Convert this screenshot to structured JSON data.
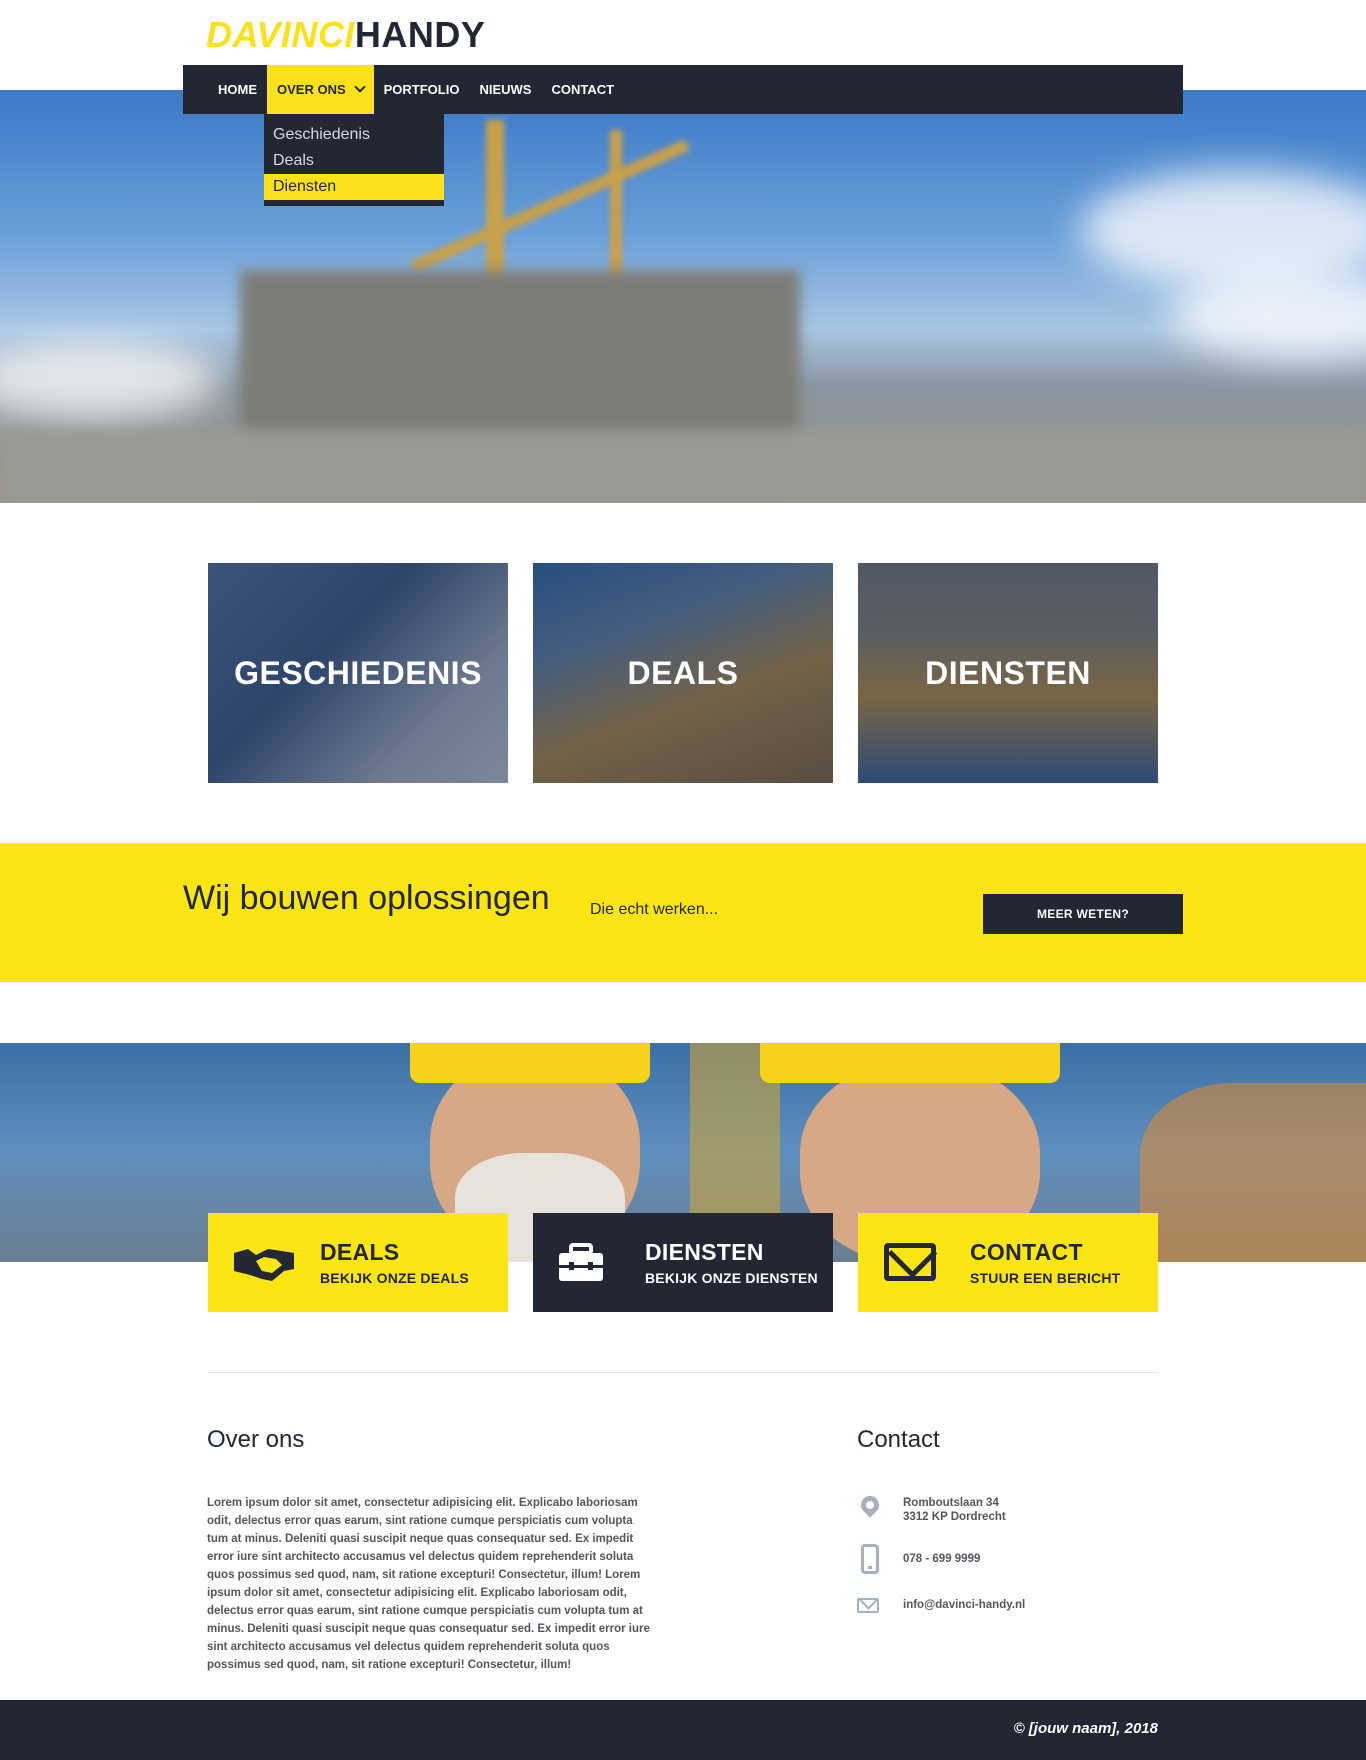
{
  "logo": {
    "part1": "DAVINCI",
    "part2": "HANDY"
  },
  "nav": {
    "items": [
      "HOME",
      "OVER ONS",
      "PORTFOLIO",
      "NIEUWS",
      "CONTACT"
    ],
    "dropdown": [
      "Geschiedenis",
      "Deals",
      "Diensten"
    ]
  },
  "tiles": [
    "GESCHIEDENIS",
    "DEALS",
    "DIENSTEN"
  ],
  "band": {
    "title": "Wij bouwen oplossingen",
    "subtitle": "Die echt werken...",
    "button": "MEER WETEN?"
  },
  "actions": [
    {
      "title": "DEALS",
      "subtitle": "BEKIJK ONZE DEALS",
      "icon": "handshake-icon"
    },
    {
      "title": "DIENSTEN",
      "subtitle": "BEKIJK ONZE DIENSTEN",
      "icon": "toolbox-icon"
    },
    {
      "title": "CONTACT",
      "subtitle": "STUUR EEN BERICHT",
      "icon": "mail-icon"
    }
  ],
  "about": {
    "title": "Over ons",
    "text": "Lorem ipsum dolor sit amet, consectetur adipisicing elit. Explicabo laboriosam odit, delectus error quas earum, sint ratione cumque perspiciatis cum volupta tum at minus. Deleniti quasi suscipit neque quas consequatur sed. Ex impedit error iure sint architecto accusamus vel delectus quidem reprehenderit soluta quos possimus sed quod, nam, sit ratione excepturi! Consectetur, illum! Lorem ipsum dolor sit amet, consectetur adipisicing elit. Explicabo laboriosam odit, delectus error quas earum, sint ratione cumque perspiciatis cum volupta tum at minus. Deleniti quasi suscipit neque quas consequatur sed. Ex impedit error iure sint architecto accusamus vel delectus quidem reprehenderit soluta quos possimus sed quod, nam, sit ratione excepturi! Consectetur, illum!"
  },
  "contact": {
    "title": "Contact",
    "address_line1": "Romboutslaan 34",
    "address_line2": "3312 KP Dordrecht",
    "phone": "078 - 699 9999",
    "email": "info@davinci-handy.nl"
  },
  "footer": {
    "copyright": "© [jouw naam], 2018"
  },
  "colors": {
    "accent": "#fbe614",
    "dark": "#222733"
  }
}
